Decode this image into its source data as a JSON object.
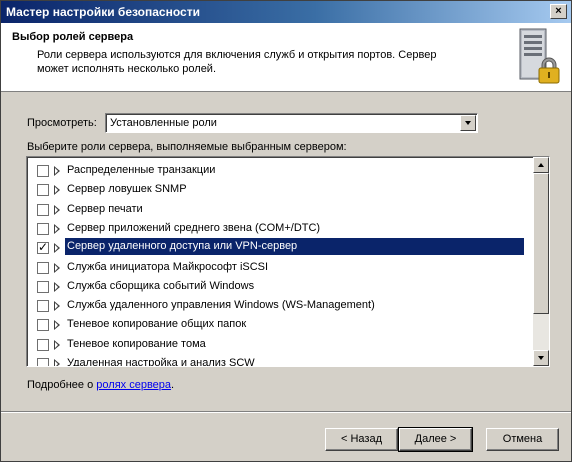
{
  "window": {
    "title": "Мастер настройки безопасности",
    "close_glyph": "×"
  },
  "header": {
    "title": "Выбор ролей сервера",
    "description": "Роли сервера используются для включения служб и открытия портов. Сервер может исполнять несколько ролей."
  },
  "view": {
    "label": "Просмотреть:",
    "selected": "Установленные роли"
  },
  "roles": {
    "label": "Выберите роли сервера, выполняемые выбранным сервером:",
    "items": [
      {
        "label": "Распределенные транзакции",
        "checked": false,
        "selected": false
      },
      {
        "label": "Сервер ловушек SNMP",
        "checked": false,
        "selected": false
      },
      {
        "label": "Сервер печати",
        "checked": false,
        "selected": false
      },
      {
        "label": "Сервер приложений среднего звена (COM+/DTC)",
        "checked": false,
        "selected": false
      },
      {
        "label": "Сервер удаленного доступа или VPN-сервер",
        "checked": true,
        "selected": true
      },
      {
        "label": "Служба инициатора Майкрософт iSCSI",
        "checked": false,
        "selected": false
      },
      {
        "label": "Служба сборщика событий Windows",
        "checked": false,
        "selected": false
      },
      {
        "label": "Служба удаленного управления Windows (WS-Management)",
        "checked": false,
        "selected": false
      },
      {
        "label": "Теневое копирование общих папок",
        "checked": false,
        "selected": false
      },
      {
        "label": "Теневое копирование тома",
        "checked": false,
        "selected": false
      },
      {
        "label": "Удаленная настройка и анализ SCW",
        "checked": false,
        "selected": false
      }
    ]
  },
  "more_info": {
    "prefix": "Подробнее о ",
    "link": "ролях сервера",
    "suffix": "."
  },
  "buttons": {
    "back": "< Назад",
    "next": "Далее >",
    "cancel": "Отмена"
  },
  "colors": {
    "selection": "#0a246a",
    "link": "#0000ee"
  }
}
